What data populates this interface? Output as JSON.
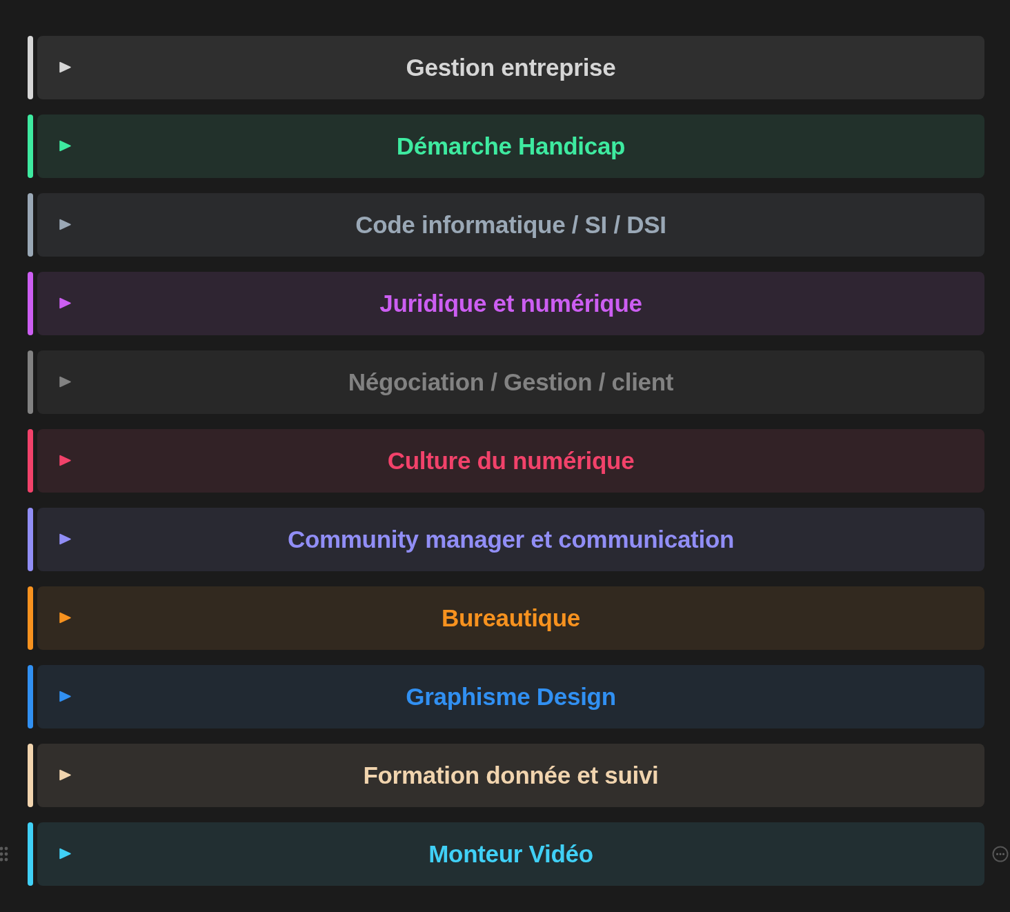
{
  "toggles": [
    {
      "title": "Gestion entreprise",
      "color": "#d6d6d6",
      "expanded": false,
      "hovered": false
    },
    {
      "title": "Démarche Handicap",
      "color": "#3eeaa0",
      "expanded": false,
      "hovered": false
    },
    {
      "title": "Code informatique / SI / DSI",
      "color": "#9aa8b6",
      "expanded": false,
      "hovered": false
    },
    {
      "title": "Juridique et numérique",
      "color": "#cc5ef2",
      "expanded": false,
      "hovered": false
    },
    {
      "title": "Négociation / Gestion / client",
      "color": "#828282",
      "expanded": false,
      "hovered": false
    },
    {
      "title": "Culture du numérique",
      "color": "#f2426a",
      "expanded": false,
      "hovered": false
    },
    {
      "title": "Community manager et communication",
      "color": "#918ef6",
      "expanded": false,
      "hovered": false
    },
    {
      "title": "Bureautique",
      "color": "#f7921f",
      "expanded": false,
      "hovered": false
    },
    {
      "title": "Graphisme Design",
      "color": "#3190f2",
      "expanded": false,
      "hovered": false
    },
    {
      "title": "Formation donnée et suivi",
      "color": "#f1d4ae",
      "expanded": false,
      "hovered": false
    },
    {
      "title": "Monteur Vidéo",
      "color": "#40d0f6",
      "expanded": false,
      "hovered": true
    }
  ]
}
